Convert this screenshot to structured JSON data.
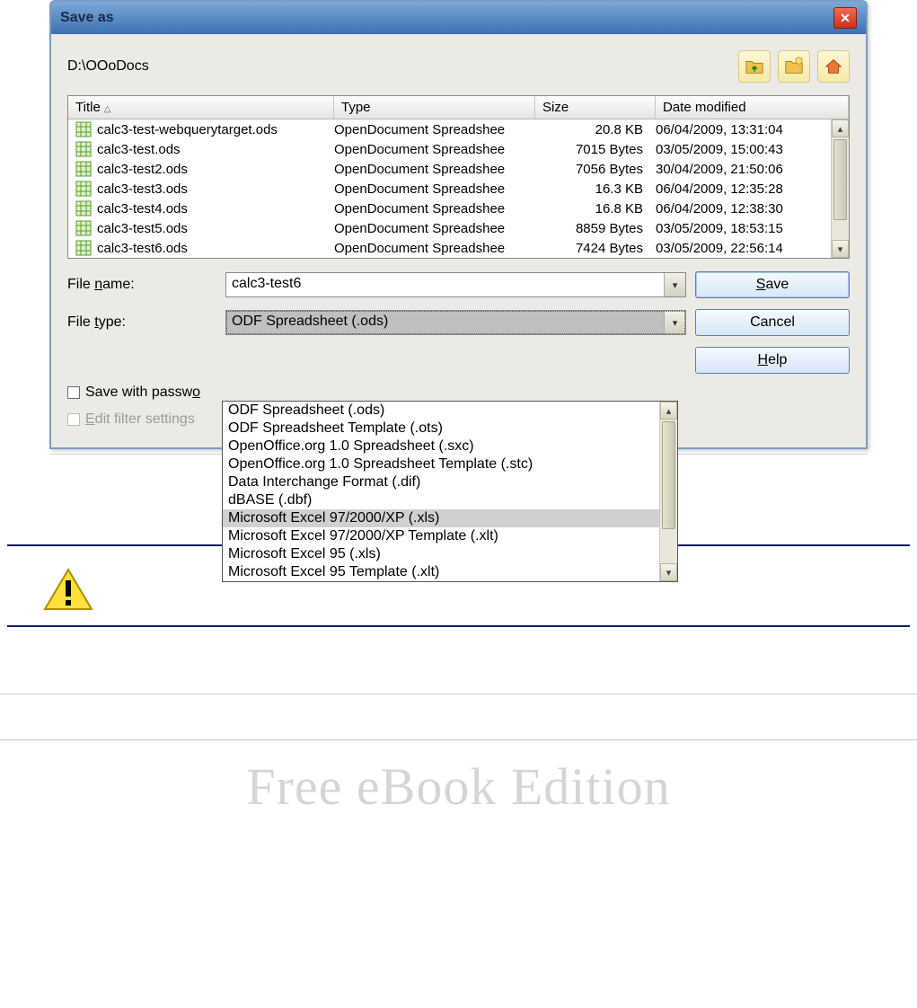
{
  "dialog": {
    "title": "Save as",
    "path": "D:\\OOoDocs",
    "columns": {
      "title": "Title",
      "type": "Type",
      "size": "Size",
      "date": "Date modified"
    },
    "files": [
      {
        "name": "calc3-test-webquerytarget.ods",
        "type": "OpenDocument Spreadshee",
        "size": "20.8 KB",
        "date": "06/04/2009, 13:31:04"
      },
      {
        "name": "calc3-test.ods",
        "type": "OpenDocument Spreadshee",
        "size": "7015 Bytes",
        "date": "03/05/2009, 15:00:43"
      },
      {
        "name": "calc3-test2.ods",
        "type": "OpenDocument Spreadshee",
        "size": "7056 Bytes",
        "date": "30/04/2009, 21:50:06"
      },
      {
        "name": "calc3-test3.ods",
        "type": "OpenDocument Spreadshee",
        "size": "16.3 KB",
        "date": "06/04/2009, 12:35:28"
      },
      {
        "name": "calc3-test4.ods",
        "type": "OpenDocument Spreadshee",
        "size": "16.8 KB",
        "date": "06/04/2009, 12:38:30"
      },
      {
        "name": "calc3-test5.ods",
        "type": "OpenDocument Spreadshee",
        "size": "8859 Bytes",
        "date": "03/05/2009, 18:53:15"
      },
      {
        "name": "calc3-test6.ods",
        "type": "OpenDocument Spreadshee",
        "size": "7424 Bytes",
        "date": "03/05/2009, 22:56:14"
      }
    ],
    "filename_label_pre": "File ",
    "filename_label_u": "n",
    "filename_label_post": "ame:",
    "filetype_label_pre": "File ",
    "filetype_label_u": "t",
    "filetype_label_post": "ype:",
    "filename_value": "calc3-test6",
    "filetype_value": "ODF Spreadsheet (.ods)",
    "options": [
      "ODF Spreadsheet (.ods)",
      "ODF Spreadsheet Template (.ots)",
      "OpenOffice.org 1.0 Spreadsheet (.sxc)",
      "OpenOffice.org 1.0 Spreadsheet Template (.stc)",
      "Data Interchange Format (.dif)",
      "dBASE (.dbf)",
      "Microsoft Excel 97/2000/XP (.xls)",
      "Microsoft Excel 97/2000/XP Template (.xlt)",
      "Microsoft Excel 95 (.xls)",
      "Microsoft Excel 95 Template (.xlt)"
    ],
    "buttons": {
      "save_pre": "",
      "save_u": "S",
      "save_post": "ave",
      "cancel": "Cancel",
      "help_pre": "",
      "help_u": "H",
      "help_post": "elp"
    },
    "checkbox_password_pre": "Save with passw",
    "checkbox_password_u": "o",
    "checkbox_password_post": "",
    "checkbox_filter_pre": "",
    "checkbox_filter_u": "E",
    "checkbox_filter_post": "dit filter settings"
  },
  "footer": "Free eBook Edition"
}
